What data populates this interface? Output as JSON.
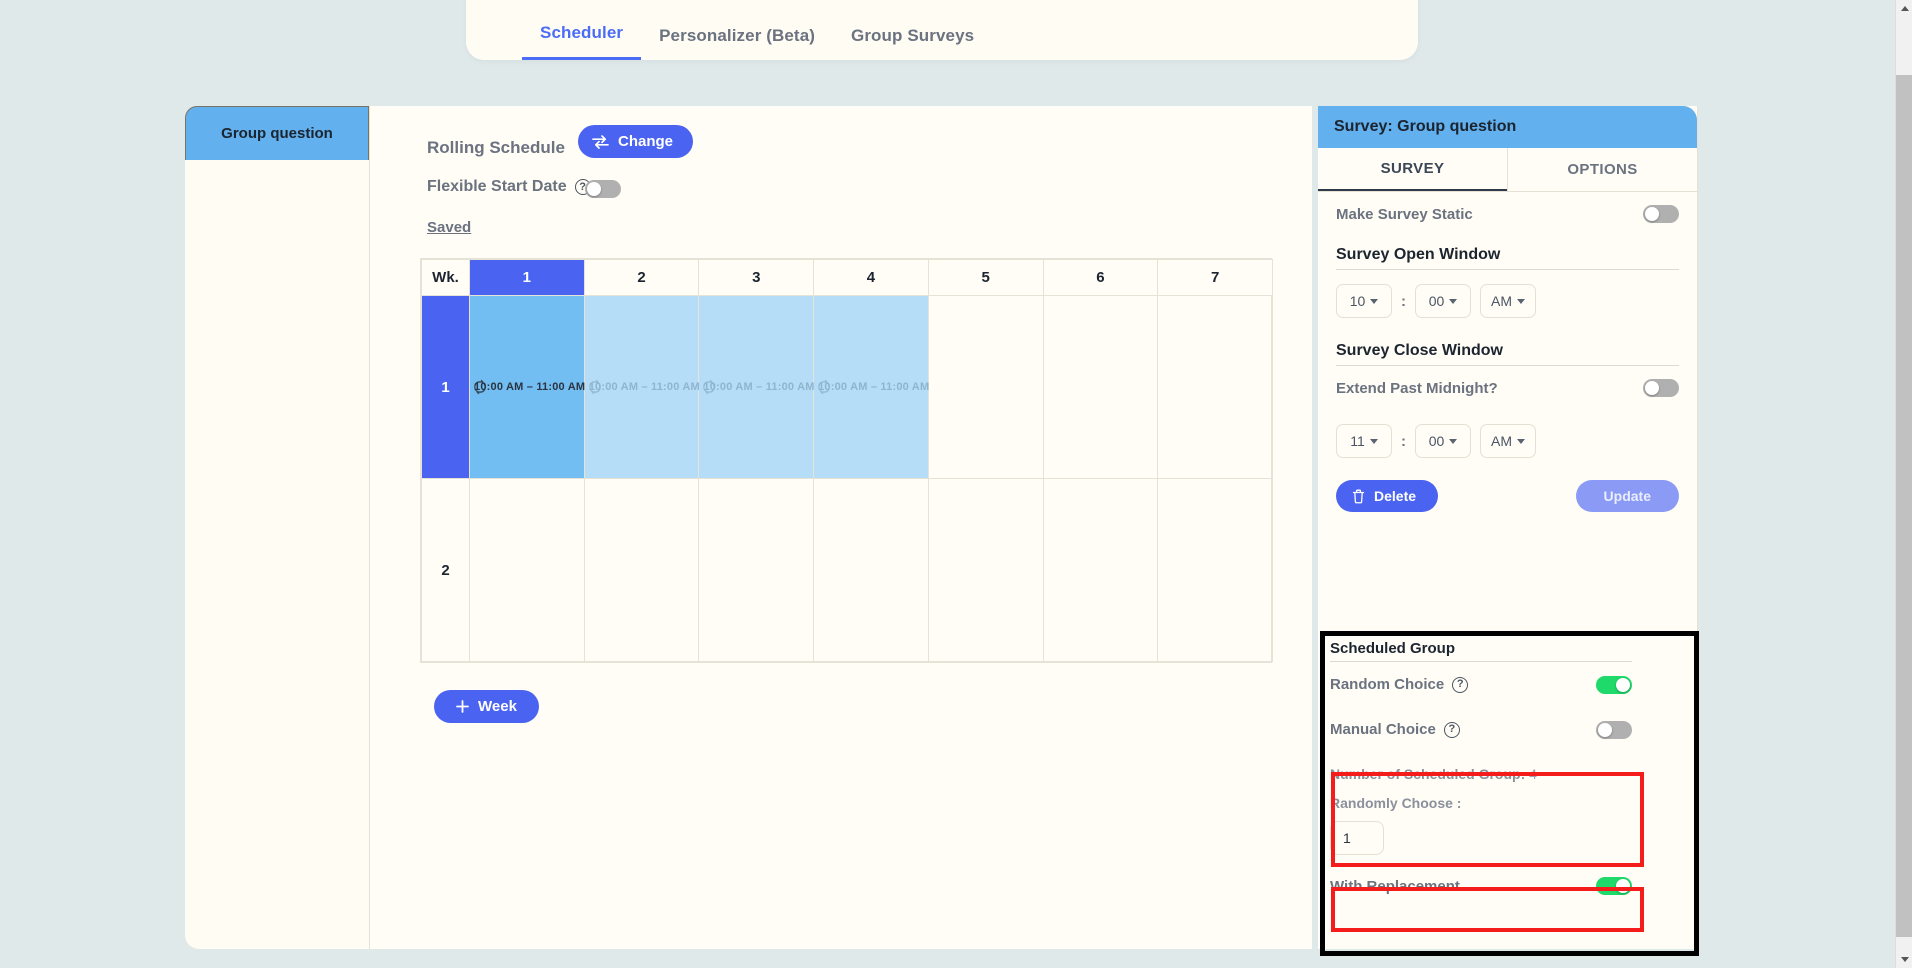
{
  "top_tabs": [
    {
      "label": "Scheduler",
      "active": true
    },
    {
      "label": "Personalizer (Beta)",
      "active": false
    },
    {
      "label": "Group Surveys",
      "active": false
    }
  ],
  "question_tab": {
    "label": "Group question"
  },
  "scheduler": {
    "rolling_schedule_label": "Rolling Schedule",
    "change_button": "Change",
    "change_icon": "swap-icon",
    "flexible_start_date_label": "Flexible Start Date",
    "flexible_start_date_on": false,
    "saved_label": "Saved",
    "add_week_button": "+ Week",
    "add_week_icon": "plus-icon",
    "grid": {
      "corner_label": "Wk.",
      "day_headers": [
        "1",
        "2",
        "3",
        "4",
        "5",
        "6",
        "7"
      ],
      "selected_day_index": 0,
      "rows": [
        {
          "week_label": "1",
          "selected": true,
          "cells": [
            {
              "text": "10:00 AM – 11:00 AM",
              "state": "selected",
              "icon": "repeat-icon"
            },
            {
              "text": "10:00 AM – 11:00 AM",
              "state": "scheduled",
              "icon": "repeat-icon"
            },
            {
              "text": "10:00 AM – 11:00 AM",
              "state": "scheduled",
              "icon": "repeat-icon"
            },
            {
              "text": "10:00 AM – 11:00 AM",
              "state": "scheduled",
              "icon": "repeat-icon"
            },
            {
              "text": "",
              "state": "empty",
              "icon": ""
            },
            {
              "text": "",
              "state": "empty",
              "icon": ""
            },
            {
              "text": "",
              "state": "empty",
              "icon": ""
            }
          ]
        },
        {
          "week_label": "2",
          "selected": false,
          "cells": [
            {
              "text": "",
              "state": "empty",
              "icon": ""
            },
            {
              "text": "",
              "state": "empty",
              "icon": ""
            },
            {
              "text": "",
              "state": "empty",
              "icon": ""
            },
            {
              "text": "",
              "state": "empty",
              "icon": ""
            },
            {
              "text": "",
              "state": "empty",
              "icon": ""
            },
            {
              "text": "",
              "state": "empty",
              "icon": ""
            },
            {
              "text": "",
              "state": "empty",
              "icon": ""
            }
          ]
        }
      ]
    }
  },
  "survey_panel": {
    "header": "Survey: Group question",
    "tabs": [
      {
        "label": "SURVEY",
        "active": true
      },
      {
        "label": "OPTIONS",
        "active": false
      }
    ],
    "make_survey_static_label": "Make Survey Static",
    "make_survey_static_on": false,
    "open_window": {
      "title": "Survey Open Window",
      "hour": "10",
      "separator": ":",
      "minute": "00",
      "meridiem": "AM"
    },
    "close_window": {
      "title": "Survey Close Window",
      "extend_past_midnight_label": "Extend Past Midnight?",
      "extend_past_midnight_on": false,
      "hour": "11",
      "separator": ":",
      "minute": "00",
      "meridiem": "AM"
    },
    "delete_button": "Delete",
    "delete_icon": "trash-icon",
    "update_button": "Update",
    "scheduled_group": {
      "title": "Scheduled Group",
      "random_choice_label": "Random Choice",
      "random_choice_on": true,
      "manual_choice_label": "Manual Choice",
      "manual_choice_on": false,
      "number_label": "Number of Scheduled Group:",
      "number_value": "4",
      "randomly_choose_label": "Randomly Choose :",
      "randomly_choose_value": "1",
      "with_replacement_label": "With Replacement",
      "with_replacement_on": true
    }
  },
  "colors": {
    "accent_blue": "#4a63f0",
    "panel_blue": "#62b0ed",
    "cell_selected": "#72bdf2",
    "cell_scheduled": "#b6ddf7",
    "toggle_on": "#1fd96a",
    "highlight_black": "#000000",
    "highlight_red": "#f51c1c",
    "page_bg": "#dfe9ea",
    "card_bg": "#fffdf5"
  }
}
